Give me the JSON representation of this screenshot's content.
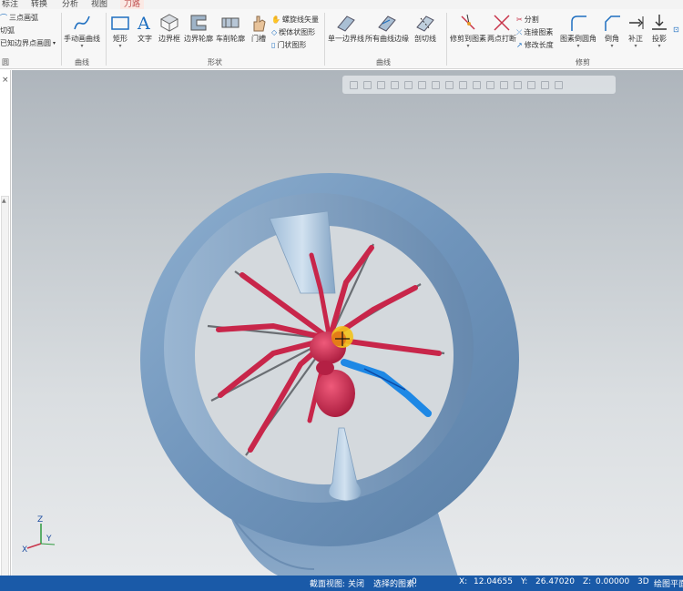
{
  "menu": {
    "tabs": [
      "标注",
      "转换",
      "分析",
      "视图",
      "刀路"
    ],
    "active_index": 4
  },
  "ribbon": {
    "left_cut": {
      "items": [
        "三点画弧",
        "切弧",
        "已知边界点画圆"
      ],
      "group_label": "圆"
    },
    "groups": [
      {
        "id": "curve1",
        "title": "曲线",
        "buttons": [
          "手动画曲线"
        ]
      },
      {
        "id": "shape",
        "title": "形状",
        "buttons": [
          "矩形",
          "文字",
          "边界框",
          "边界轮廓",
          "车削轮廓",
          "门槽"
        ],
        "small": [
          "螺旋线矢量",
          "楔体状图形",
          "门状图形"
        ]
      },
      {
        "id": "curve2",
        "title": "曲线",
        "buttons": [
          "单一边界线",
          "所有曲线边缘",
          "剖切线"
        ]
      },
      {
        "id": "modify",
        "title": "修剪",
        "buttons": [
          "修剪到图素",
          "两点打断",
          "图素倒圆角",
          "倒角",
          "补正",
          "投影"
        ],
        "small": [
          "分割",
          "连接图素",
          "修改长度"
        ]
      }
    ]
  },
  "left_panel": {
    "close": "×"
  },
  "viewport": {
    "scene_description": "3D model of a spider on a wheel"
  },
  "axes": {
    "x": "X",
    "y": "Y",
    "z": "Z"
  },
  "status": {
    "section_view_label": "截面视图:",
    "section_view_value": "关闭",
    "selected_label": "选择的图素:",
    "selected_value": "0",
    "x_label": "X:",
    "x_value": "12.04655",
    "y_label": "Y:",
    "y_value": "26.47020",
    "z_label": "Z:",
    "z_value": "0.00000",
    "mode": "3D",
    "plane": "绘图平面"
  },
  "colors": {
    "status_bg": "#1a5aa8",
    "wheel_blue": "#7698bc",
    "spider_red": "#c8264a",
    "highlight_blue": "#1e88e5"
  }
}
